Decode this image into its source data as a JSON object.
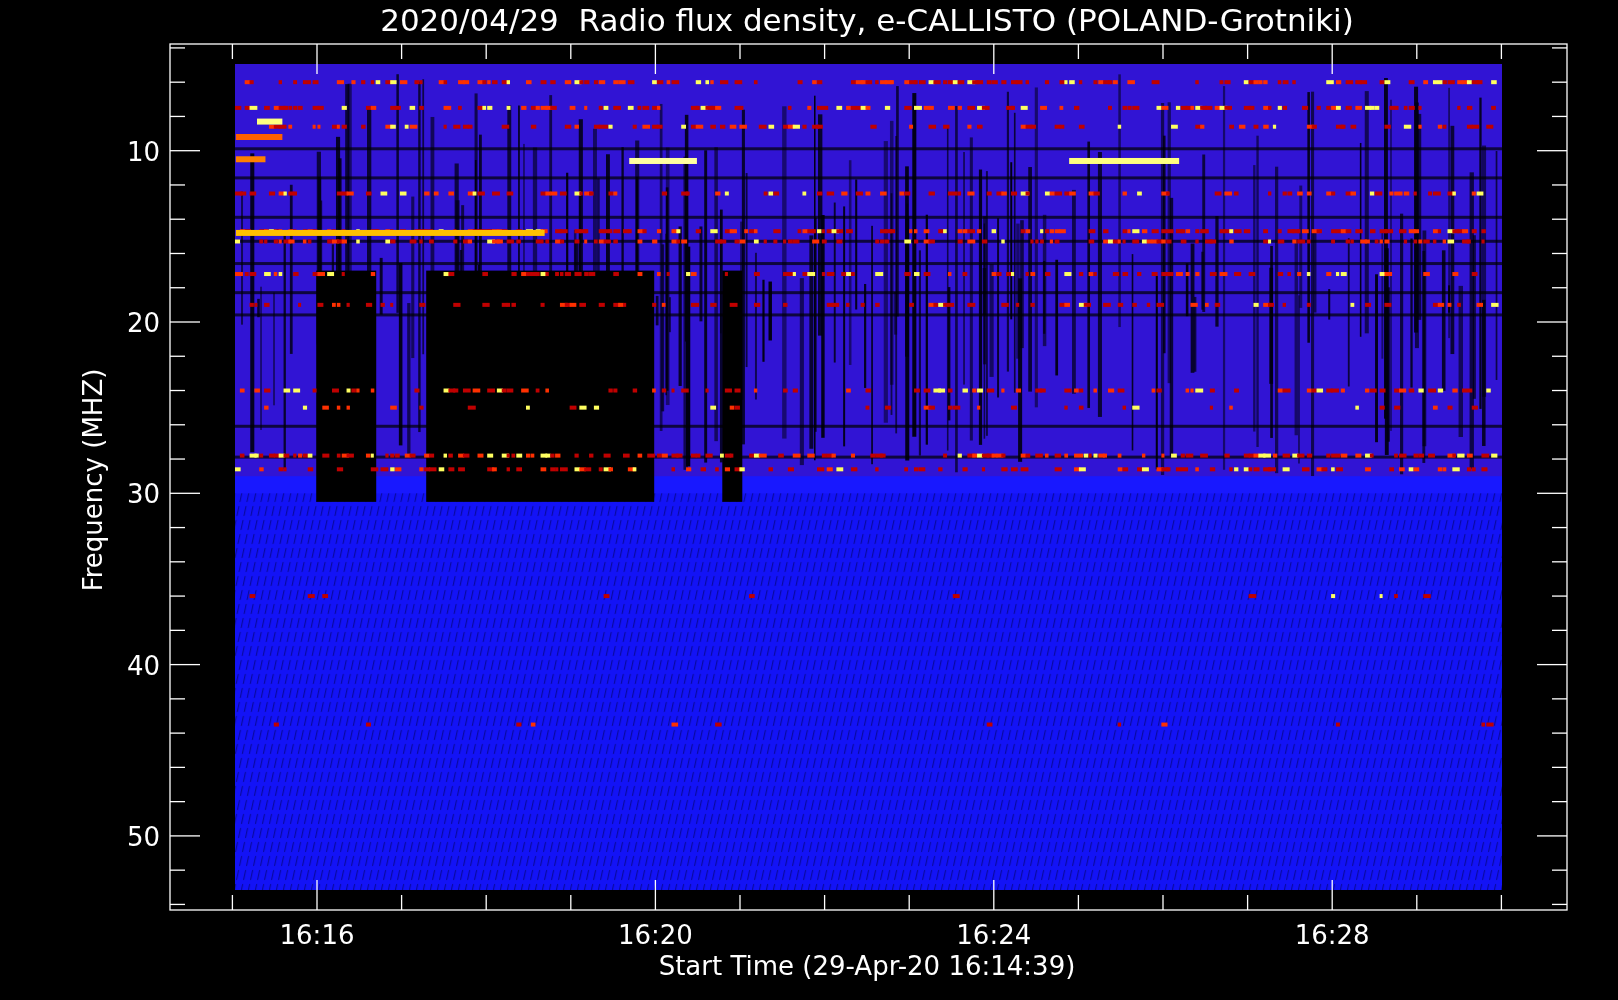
{
  "title": "2020/04/29  Radio flux density, e-CALLISTO (POLAND-Grotniki)",
  "plot": {
    "xlabel": "Start Time (29-Apr-20 16:14:39)",
    "ylabel": "Frequency (MHZ)",
    "yticks": [
      "10",
      "20",
      "30",
      "40",
      "50"
    ],
    "xticks": [
      "16:16",
      "16:20",
      "16:24",
      "16:28"
    ]
  }
}
